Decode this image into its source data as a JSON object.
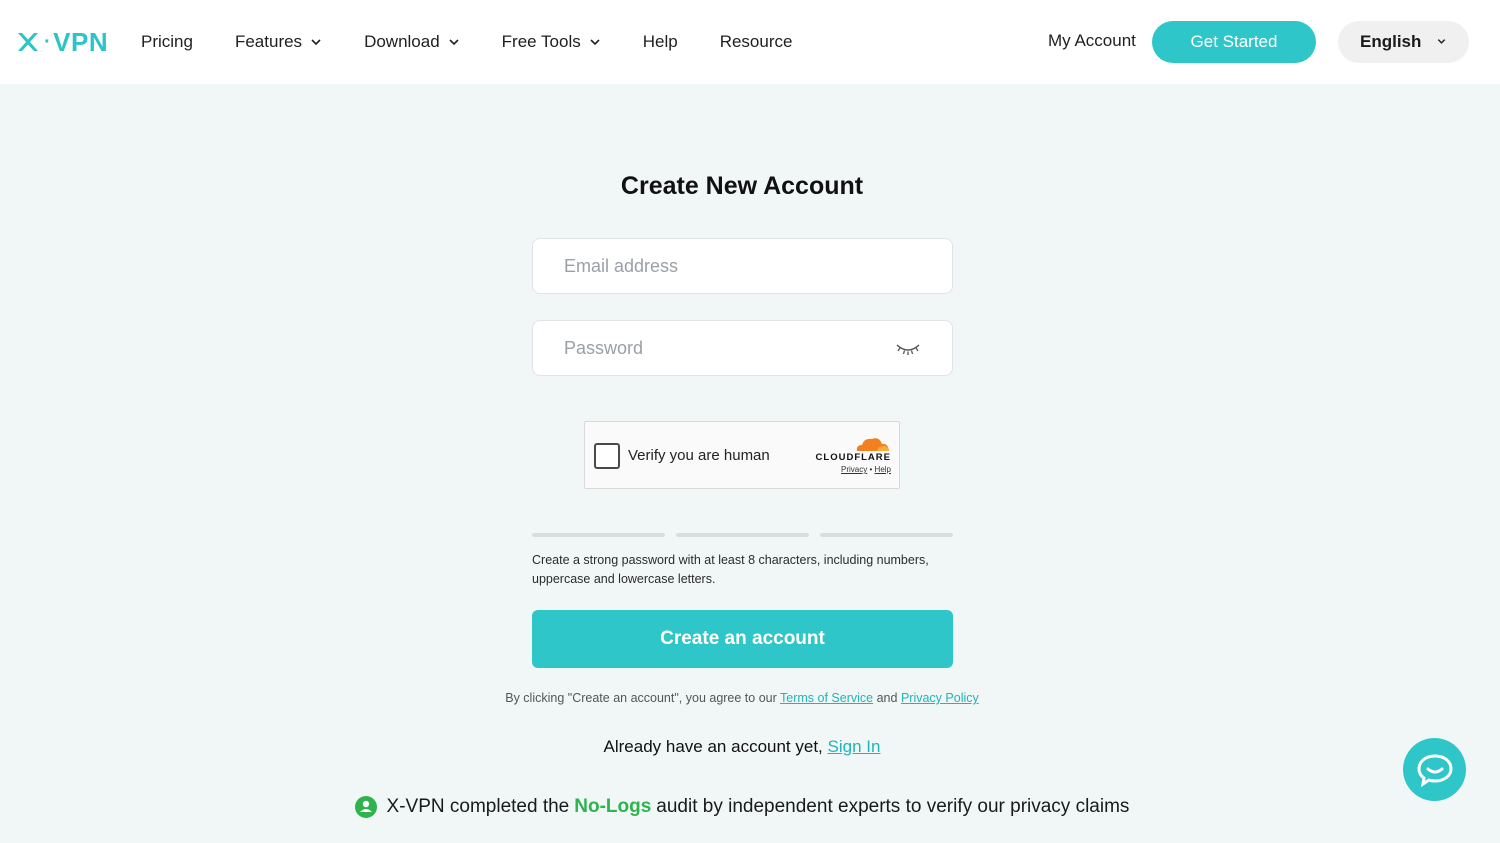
{
  "brand": {
    "name": "X-VPN",
    "x": "X",
    "vpn": "VPN"
  },
  "nav": {
    "items": [
      {
        "label": "Pricing",
        "has_dropdown": false
      },
      {
        "label": "Features",
        "has_dropdown": true
      },
      {
        "label": "Download",
        "has_dropdown": true
      },
      {
        "label": "Free Tools",
        "has_dropdown": true
      },
      {
        "label": "Help",
        "has_dropdown": false
      },
      {
        "label": "Resource",
        "has_dropdown": false
      }
    ],
    "my_account": "My Account",
    "get_started": "Get Started",
    "language": "English"
  },
  "form": {
    "title": "Create New Account",
    "email_placeholder": "Email address",
    "email_value": "",
    "password_placeholder": "Password",
    "password_value": "",
    "captcha": {
      "label": "Verify you are human",
      "provider": "CLOUDFLARE",
      "privacy": "Privacy",
      "separator": "•",
      "help": "Help"
    },
    "password_hint": "Create a strong password with at least 8 characters, including numbers, uppercase and lowercase letters.",
    "submit_label": "Create an account",
    "terms_prefix": "By clicking \"Create an account\", you agree to our",
    "terms_link": "Terms of Service",
    "terms_and": "and",
    "privacy_link": "Privacy Policy",
    "signin_prefix": "Already have an account yet,",
    "signin_link": "Sign In"
  },
  "audit": {
    "prefix": "X-VPN completed the",
    "highlight": "No-Logs",
    "suffix": "audit by independent experts to verify our privacy claims"
  },
  "colors": {
    "accent": "#2ec6c9",
    "background": "#f1f7f7",
    "audit_green": "#2fb34f",
    "cloudflare_orange": "#f38020"
  }
}
